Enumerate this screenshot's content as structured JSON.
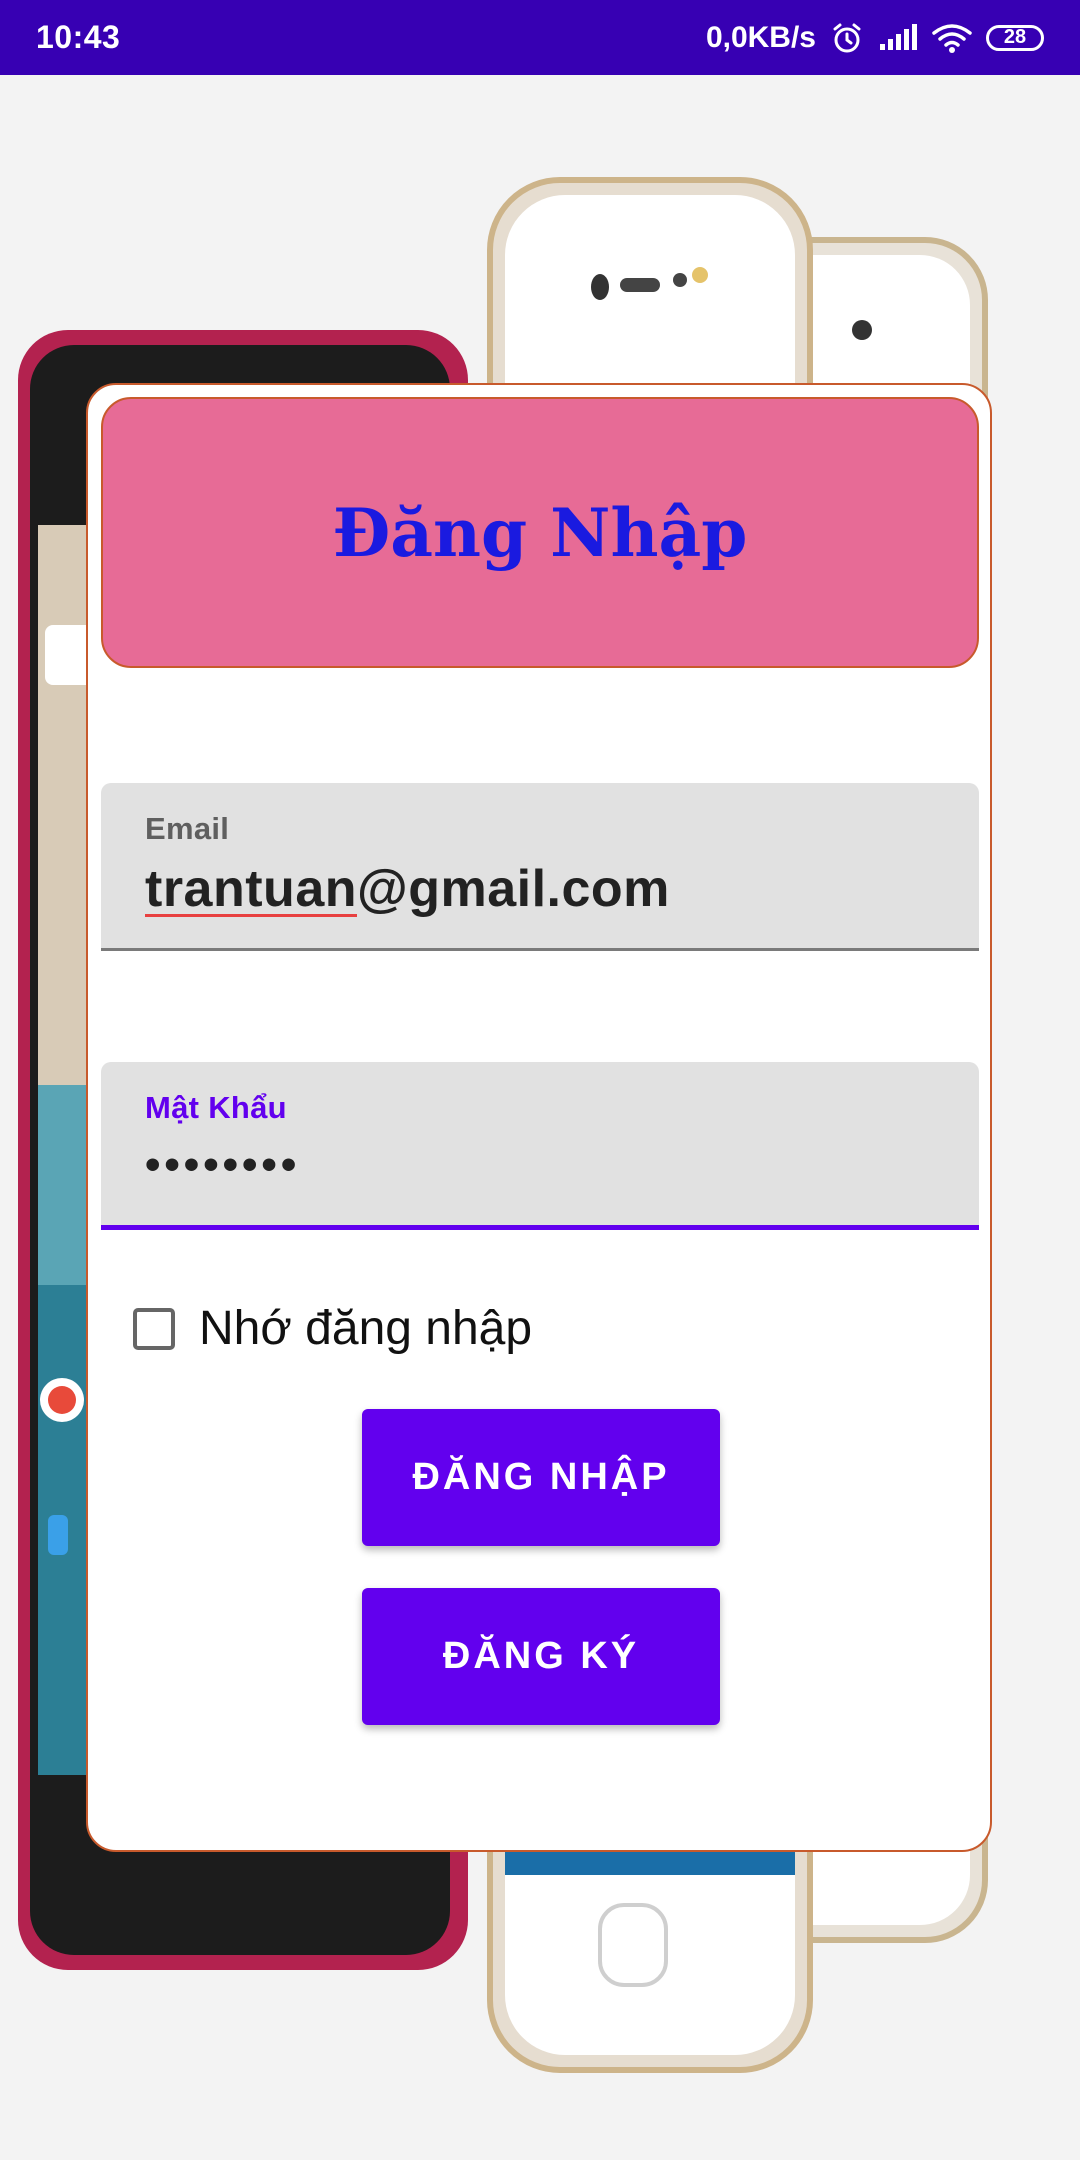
{
  "status_bar": {
    "time": "10:43",
    "network_speed": "0,0KB/s",
    "battery_level": "28",
    "icons": [
      "alarm-icon",
      "signal-icon",
      "wifi-icon",
      "battery-icon"
    ]
  },
  "login_card": {
    "title": "Đăng Nhập",
    "email": {
      "label": "Email",
      "value_misspelled_part": "trantuan",
      "value_rest": "@gmail.com"
    },
    "password": {
      "label": "Mật Khẩu",
      "value": "••••••••"
    },
    "remember_me": {
      "label": "Nhớ đăng nhập",
      "checked": false
    },
    "login_button": "ĐĂNG NHẬP",
    "register_button": "ĐĂNG KÝ"
  },
  "colors": {
    "status_bar": "#3700b3",
    "header_box": "#e76b96",
    "title_text": "#1a1ae0",
    "primary": "#6200ee",
    "card_border": "#c85a2c"
  }
}
